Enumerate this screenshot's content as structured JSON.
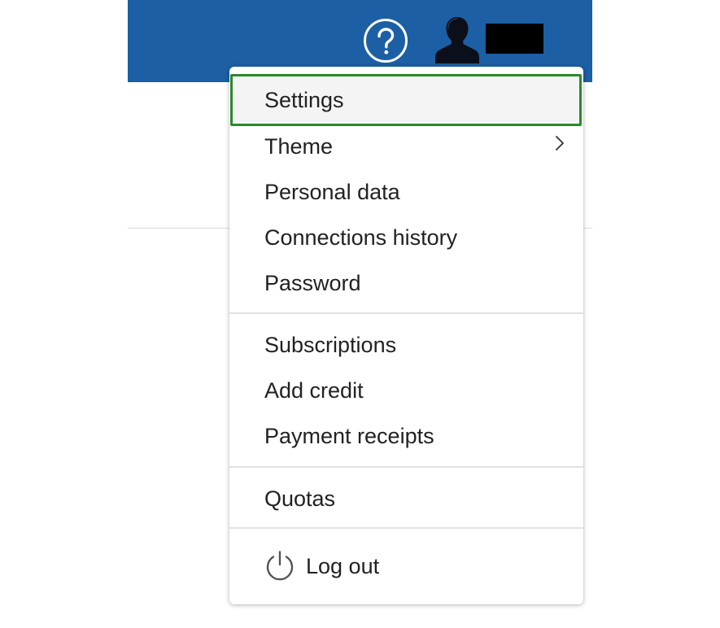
{
  "header": {
    "help_icon": "help-circle-icon",
    "avatar_icon": "user-silhouette-icon",
    "username": "",
    "bar_color": "#1c5fa4"
  },
  "menu": {
    "highlight_color": "#2a8a2a",
    "groups": [
      {
        "items": [
          {
            "label": "Settings",
            "highlighted": true
          },
          {
            "label": "Theme",
            "has_submenu": true
          },
          {
            "label": "Personal data"
          },
          {
            "label": "Connections history"
          },
          {
            "label": "Password"
          }
        ]
      },
      {
        "items": [
          {
            "label": "Subscriptions"
          },
          {
            "label": "Add credit"
          },
          {
            "label": "Payment receipts"
          }
        ]
      },
      {
        "items": [
          {
            "label": "Quotas"
          }
        ]
      },
      {
        "items": [
          {
            "label": "Log out",
            "icon": "power-icon"
          }
        ]
      }
    ]
  }
}
